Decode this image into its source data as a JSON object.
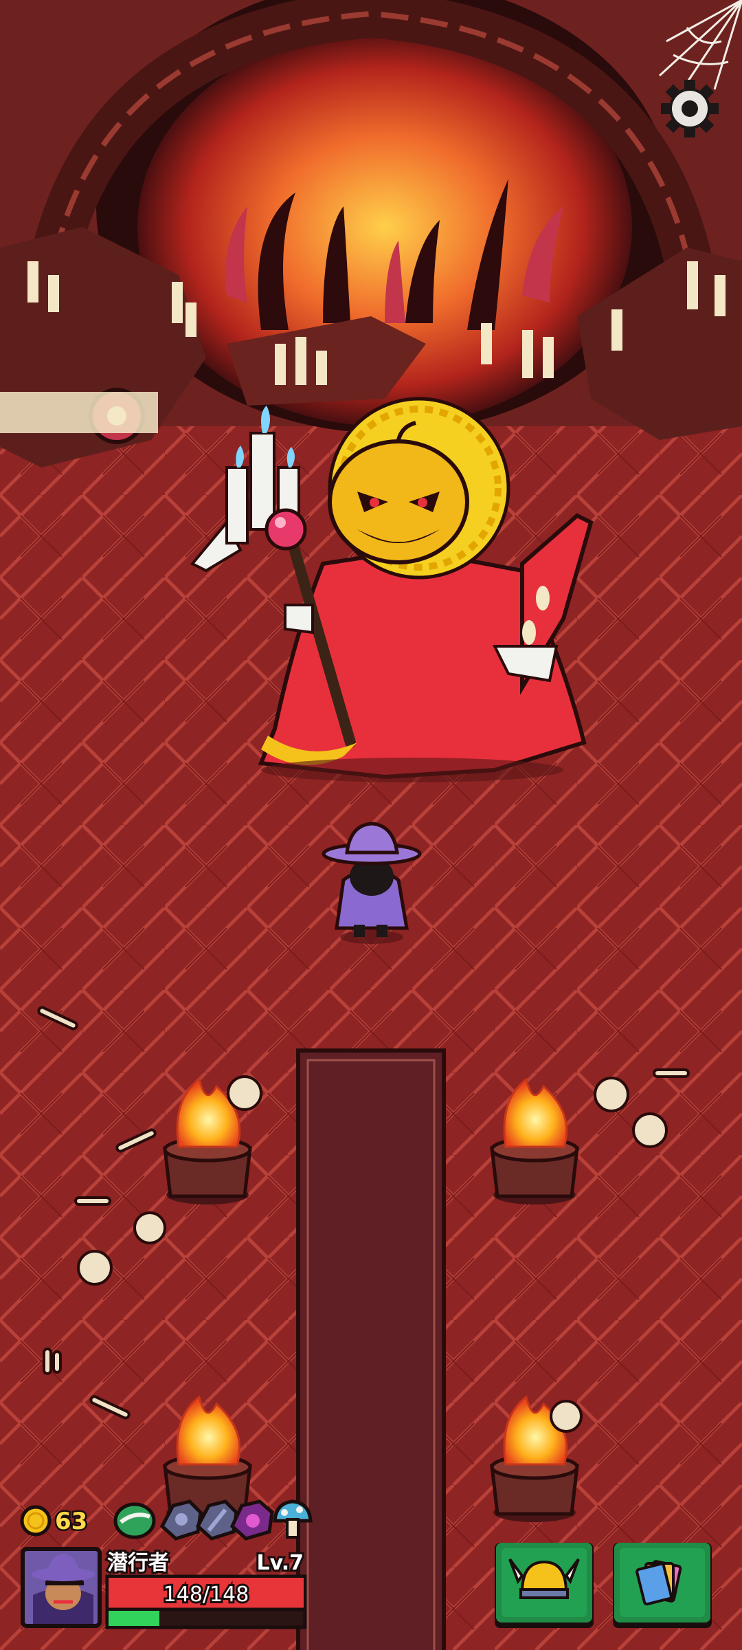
{
  "hud": {
    "coins": "63",
    "player_name": "潜行者",
    "level": "Lv.7",
    "hp_text": "148/148",
    "hp_fraction": 1.0,
    "xp_fraction": 0.26
  },
  "status_icons": [
    "green-bean-icon",
    "shield-rune-icon",
    "sword-rune-icon",
    "purple-rune-icon",
    "mushroom-icon"
  ],
  "buttons": {
    "equipment": "viking-helmet-icon",
    "cards": "cards-icon",
    "settings": "gear-icon"
  },
  "colors": {
    "floor": "#8e2423",
    "hp_bar": "#e8353a",
    "xp_bar": "#32d35b",
    "button_green": "#1f8c47",
    "carpet": "#5e2024",
    "coin": "#f5c21b"
  }
}
